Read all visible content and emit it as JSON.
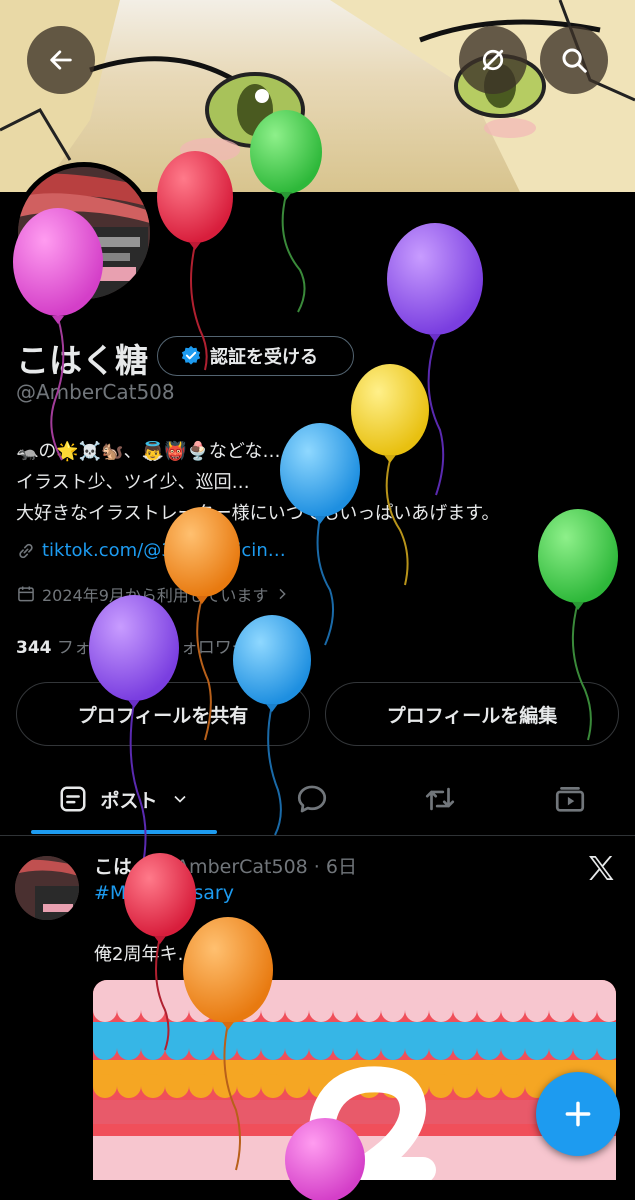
{
  "header": {
    "back_icon": "arrow-left-icon",
    "grok_icon": "slash-circle-icon",
    "search_icon": "search-icon"
  },
  "profile": {
    "name": "こはく糖",
    "verify_label": "認証を受ける",
    "handle": "@AmberCat508",
    "bio_line1": "🦡の🌟☠️🐿️、👼👹🍨などな…",
    "bio_line2": "イラスト少、ツイ少、巡回…",
    "bio_line3": "大好きなイラストレーター様にいつでもいっぱいあげます。",
    "link": "tiktok.com/@3… medicin…",
    "joined": "2024年9月から利用しています",
    "following_count": "344",
    "following_label": "フォロー",
    "followers_count": "0",
    "followers_label": "フォロワー",
    "share_button": "プロフィールを共有",
    "edit_button": "プロフィールを編集"
  },
  "tabs": {
    "posts_label": "ポスト",
    "replies_icon": "speech-bubble-icon",
    "reposts_icon": "repost-icon",
    "media_icon": "media-icon"
  },
  "post": {
    "author": "こは…",
    "meta": "@AmberCat508 · 6日",
    "hashtag": "#M…niversary",
    "text": "俺2周年キ…"
  },
  "colors": {
    "accent": "#1d9bf0",
    "background": "#000000",
    "muted": "#71767b"
  }
}
